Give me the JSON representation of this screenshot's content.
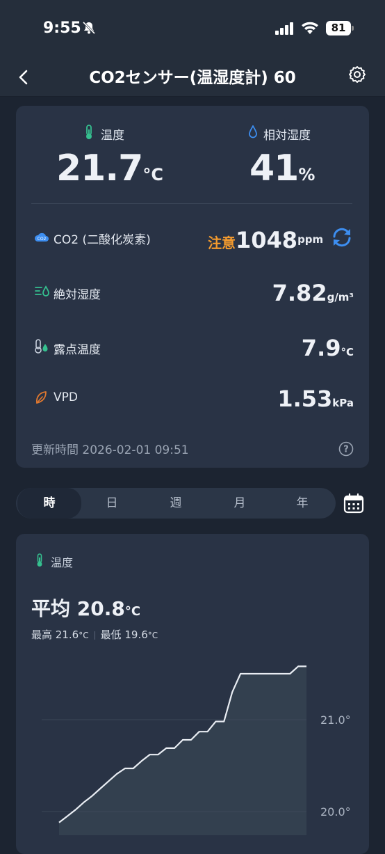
{
  "status_bar": {
    "time": "9:55",
    "battery": "81"
  },
  "nav": {
    "title": "CO2センサー(温湿度計) 60"
  },
  "current": {
    "temperature": {
      "label": "温度",
      "value": "21.7",
      "unit": "°C"
    },
    "humidity": {
      "label": "相対湿度",
      "value": "41",
      "unit": "%"
    },
    "co2": {
      "label": "CO2 (二酸化炭素)",
      "status": "注意",
      "value": "1048",
      "unit": "ppm"
    },
    "absolute_humidity": {
      "label": "絶対湿度",
      "value": "7.82",
      "unit": "g/m³"
    },
    "dew_point": {
      "label": "露点温度",
      "value": "7.9",
      "unit": "°C"
    },
    "vpd": {
      "label": "VPD",
      "value": "1.53",
      "unit": "kPa"
    },
    "updated": "更新時間 2026-02-01 09:51"
  },
  "tabs": [
    "時",
    "日",
    "週",
    "月",
    "年"
  ],
  "active_tab": "時",
  "history": {
    "label": "温度",
    "avg_label": "平均",
    "avg_value": "20.8",
    "unit": "°C",
    "max_label": "最高",
    "max_value": "21.6",
    "min_label": "最低",
    "min_value": "19.6"
  },
  "chart_data": {
    "type": "area",
    "y_ticks": [
      "21.0°",
      "20.0°"
    ],
    "y_tick_values": [
      21.0,
      20.0
    ],
    "x": [
      0,
      1,
      2,
      3,
      4,
      5,
      6,
      7,
      8,
      9,
      10,
      11,
      12,
      13,
      14,
      15,
      16,
      17,
      18,
      19,
      20,
      21,
      22,
      23,
      24,
      25,
      26,
      27,
      28,
      29,
      30
    ],
    "y": [
      19.88,
      19.95,
      20.02,
      20.1,
      20.17,
      20.25,
      20.33,
      20.41,
      20.47,
      20.47,
      20.55,
      20.62,
      20.62,
      20.69,
      20.69,
      20.78,
      20.78,
      20.87,
      20.87,
      20.98,
      20.98,
      21.3,
      21.5,
      21.5,
      21.5,
      21.5,
      21.5,
      21.5,
      21.5,
      21.58,
      21.58
    ],
    "colors": {
      "line": "#e9edf3",
      "fill": "#33404f",
      "grid": "#3c4758"
    }
  },
  "colors": {
    "accent": "#3d8ef0",
    "warning": "#f29a2e",
    "temp_icon": "#35c08f",
    "leaf": "#e0782f"
  }
}
